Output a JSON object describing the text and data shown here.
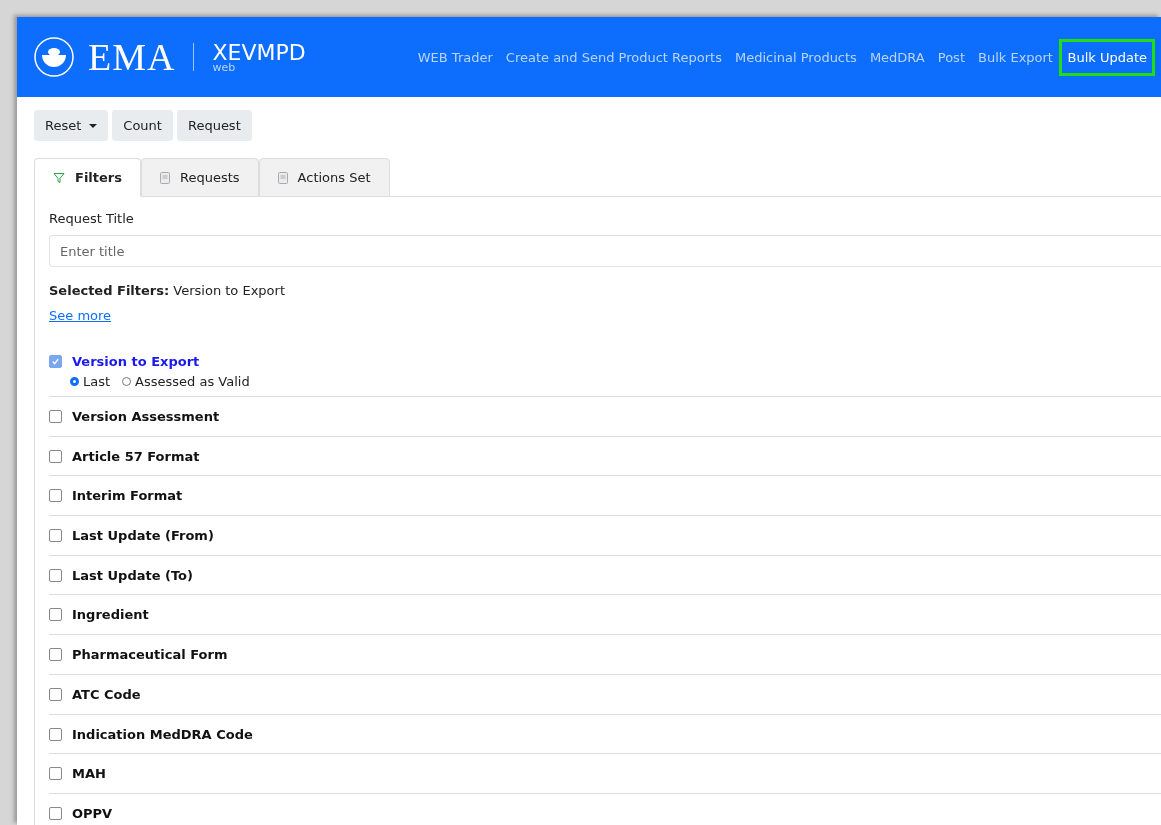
{
  "header": {
    "logo": "EMA",
    "app_name": "XEVMPD",
    "app_sub": "web",
    "nav": [
      {
        "label": "WEB Trader",
        "selected": false
      },
      {
        "label": "Create and Send Product Reports",
        "selected": false
      },
      {
        "label": "Medicinal Products",
        "selected": false
      },
      {
        "label": "MedDRA",
        "selected": false
      },
      {
        "label": "Post",
        "selected": false
      },
      {
        "label": "Bulk Export",
        "selected": false
      },
      {
        "label": "Bulk Update",
        "selected": true
      }
    ]
  },
  "toolbar": [
    {
      "label": "Reset",
      "dropdown": true
    },
    {
      "label": "Count",
      "dropdown": false
    },
    {
      "label": "Request",
      "dropdown": false
    }
  ],
  "tabs": [
    {
      "label": "Filters",
      "kind": "filter",
      "selected": true
    },
    {
      "label": "Requests",
      "kind": "doc",
      "selected": false
    },
    {
      "label": "Actions Set",
      "kind": "doc",
      "selected": false
    }
  ],
  "request_title": {
    "label": "Request Title",
    "placeholder": "Enter title"
  },
  "selected_filters": {
    "label": "Selected Filters:",
    "value": "Version to Export"
  },
  "see_more": "See more",
  "filters": [
    {
      "label": "Version to Export",
      "checked": true,
      "options": [
        {
          "label": "Last",
          "selected": true
        },
        {
          "label": "Assessed as Valid",
          "selected": false
        }
      ]
    },
    {
      "label": "Version Assessment",
      "checked": false
    },
    {
      "label": "Article 57 Format",
      "checked": false
    },
    {
      "label": "Interim Format",
      "checked": false
    },
    {
      "label": "Last Update (From)",
      "checked": false
    },
    {
      "label": "Last Update (To)",
      "checked": false
    },
    {
      "label": "Ingredient",
      "checked": false
    },
    {
      "label": "Pharmaceutical Form",
      "checked": false
    },
    {
      "label": "ATC Code",
      "checked": false
    },
    {
      "label": "Indication MedDRA Code",
      "checked": false
    },
    {
      "label": "MAH",
      "checked": false
    },
    {
      "label": "OPPV",
      "checked": false
    }
  ]
}
